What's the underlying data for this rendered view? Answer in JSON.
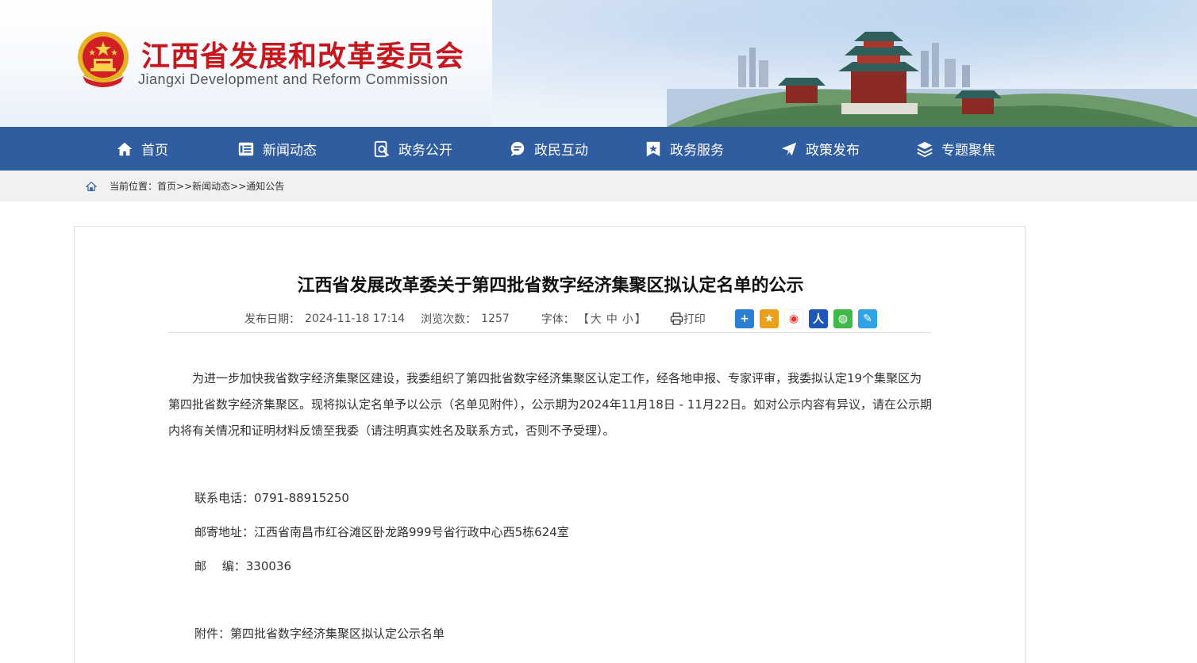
{
  "header": {
    "title_cn": "江西省发展和改革委员会",
    "title_en": "Jiangxi Development and Reform Commission",
    "brand_red": "#c8161d"
  },
  "nav": {
    "background": "#2f5d9f",
    "items": [
      {
        "label": "首页",
        "icon": "home-icon"
      },
      {
        "label": "新闻动态",
        "icon": "news-icon"
      },
      {
        "label": "政务公开",
        "icon": "search-doc-icon"
      },
      {
        "label": "政民互动",
        "icon": "chat-icon"
      },
      {
        "label": "政务服务",
        "icon": "star-badge-icon"
      },
      {
        "label": "政策发布",
        "icon": "paper-plane-icon"
      },
      {
        "label": "专题聚焦",
        "icon": "layers-icon"
      }
    ]
  },
  "breadcrumb": {
    "prefix": "当前位置：",
    "items": [
      "首页",
      "新闻动态",
      "通知公告"
    ],
    "sep": ">>"
  },
  "article": {
    "title": "江西省发展改革委关于第四批省数字经济集聚区拟认定名单的公示",
    "date_label": "发布日期：",
    "date": "2024-11-18 17:14",
    "views_label": "浏览次数：",
    "views": "1257",
    "font_label": "字体：",
    "font_open": "【",
    "font_large": "大",
    "font_medium": "中",
    "font_small": "小",
    "font_close": "】",
    "print_label": "打印",
    "share_icons": [
      "plus-share-icon",
      "qzone-icon",
      "weibo-icon",
      "people-icon",
      "wechat-icon",
      "edit-share-icon"
    ],
    "paragraph": "为进一步加快我省数字经济集聚区建设，我委组织了第四批省数字经济集聚区认定工作，经各地申报、专家评审，我委拟认定19个集聚区为第四批省数字经济集聚区。现将拟认定名单予以公示（名单见附件），公示期为2024年11月18日 - 11月22日。如对公示内容有异议，请在公示期内将有关情况和证明材料反馈至我委（请注明真实姓名及联系方式，否则不予受理）。",
    "phone": "联系电话：0791-88915250",
    "address": "邮寄地址：江西省南昌市红谷滩区卧龙路999号省行政中心西5栋624室",
    "postcode": "邮　 编：330036",
    "attachment_label": "附件：",
    "attachment_link": "第四批省数字经济集聚区拟认定公示名单"
  }
}
